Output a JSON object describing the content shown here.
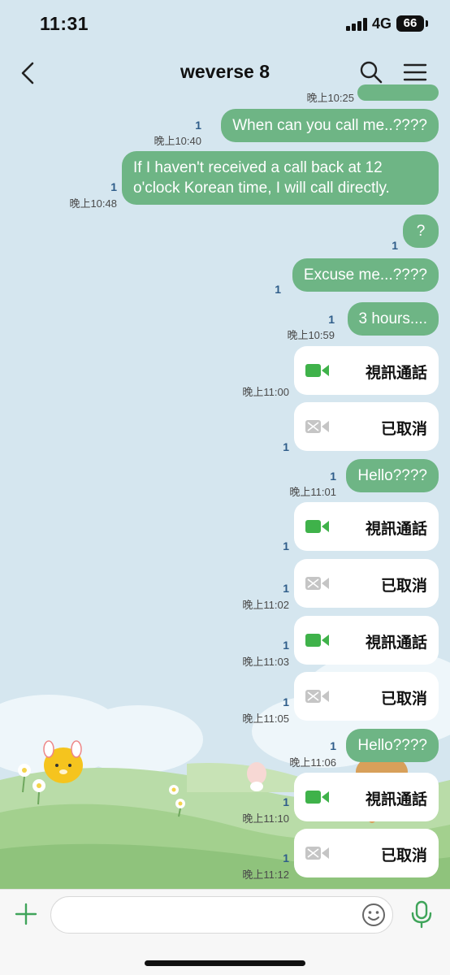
{
  "status_bar": {
    "time": "11:31",
    "network": "4G",
    "battery": "66"
  },
  "header": {
    "title": "weverse 8",
    "back_icon": "chevron-left-icon",
    "search_icon": "search-icon",
    "menu_icon": "hamburger-menu-icon"
  },
  "messages": [
    {
      "type": "partial",
      "time": "晚上10:25"
    },
    {
      "type": "text",
      "text": "When can you call me..????",
      "read": "1",
      "time": "晚上10:40"
    },
    {
      "type": "text",
      "lines": [
        "If I haven't received a call back at 12",
        "o'clock Korean time, I will call directly."
      ],
      "read": "1",
      "time": "晚上10:48"
    },
    {
      "type": "text",
      "text": "?",
      "read": "1",
      "time": ""
    },
    {
      "type": "text",
      "text": "Excuse me...????",
      "read": "1",
      "time": ""
    },
    {
      "type": "text",
      "text": "3 hours....",
      "read": "1",
      "time": "晚上10:59"
    },
    {
      "type": "call",
      "label": "視訊通話",
      "status": "active",
      "read": "",
      "time": "晚上11:00"
    },
    {
      "type": "call",
      "label": "已取消",
      "status": "cancelled",
      "read": "1",
      "time": ""
    },
    {
      "type": "text",
      "text": "Hello????",
      "read": "1",
      "time": "晚上11:01"
    },
    {
      "type": "call",
      "label": "視訊通話",
      "status": "active",
      "read": "1",
      "time": ""
    },
    {
      "type": "call",
      "label": "已取消",
      "status": "cancelled",
      "read": "1",
      "time": "晚上11:02"
    },
    {
      "type": "call",
      "label": "視訊通話",
      "status": "active",
      "read": "1",
      "time": "晚上11:03"
    },
    {
      "type": "call",
      "label": "已取消",
      "status": "cancelled",
      "read": "1",
      "time": "晚上11:05"
    },
    {
      "type": "text",
      "text": "Hello????",
      "read": "1",
      "time": "晚上11:06"
    },
    {
      "type": "call",
      "label": "視訊通話",
      "status": "active",
      "read": "1",
      "time": "晚上11:10"
    },
    {
      "type": "call",
      "label": "已取消",
      "status": "cancelled",
      "read": "1",
      "time": "晚上11:12"
    }
  ],
  "input_bar": {
    "placeholder": "",
    "plus_icon": "plus-icon",
    "emoji_icon": "emoji-icon",
    "mic_icon": "microphone-icon"
  },
  "colors": {
    "bubble": "#6eb585",
    "video_active": "#3fb24a",
    "video_cancelled": "#c5c5c5",
    "accent": "#3fa45a",
    "background": "#d5e6ef"
  }
}
